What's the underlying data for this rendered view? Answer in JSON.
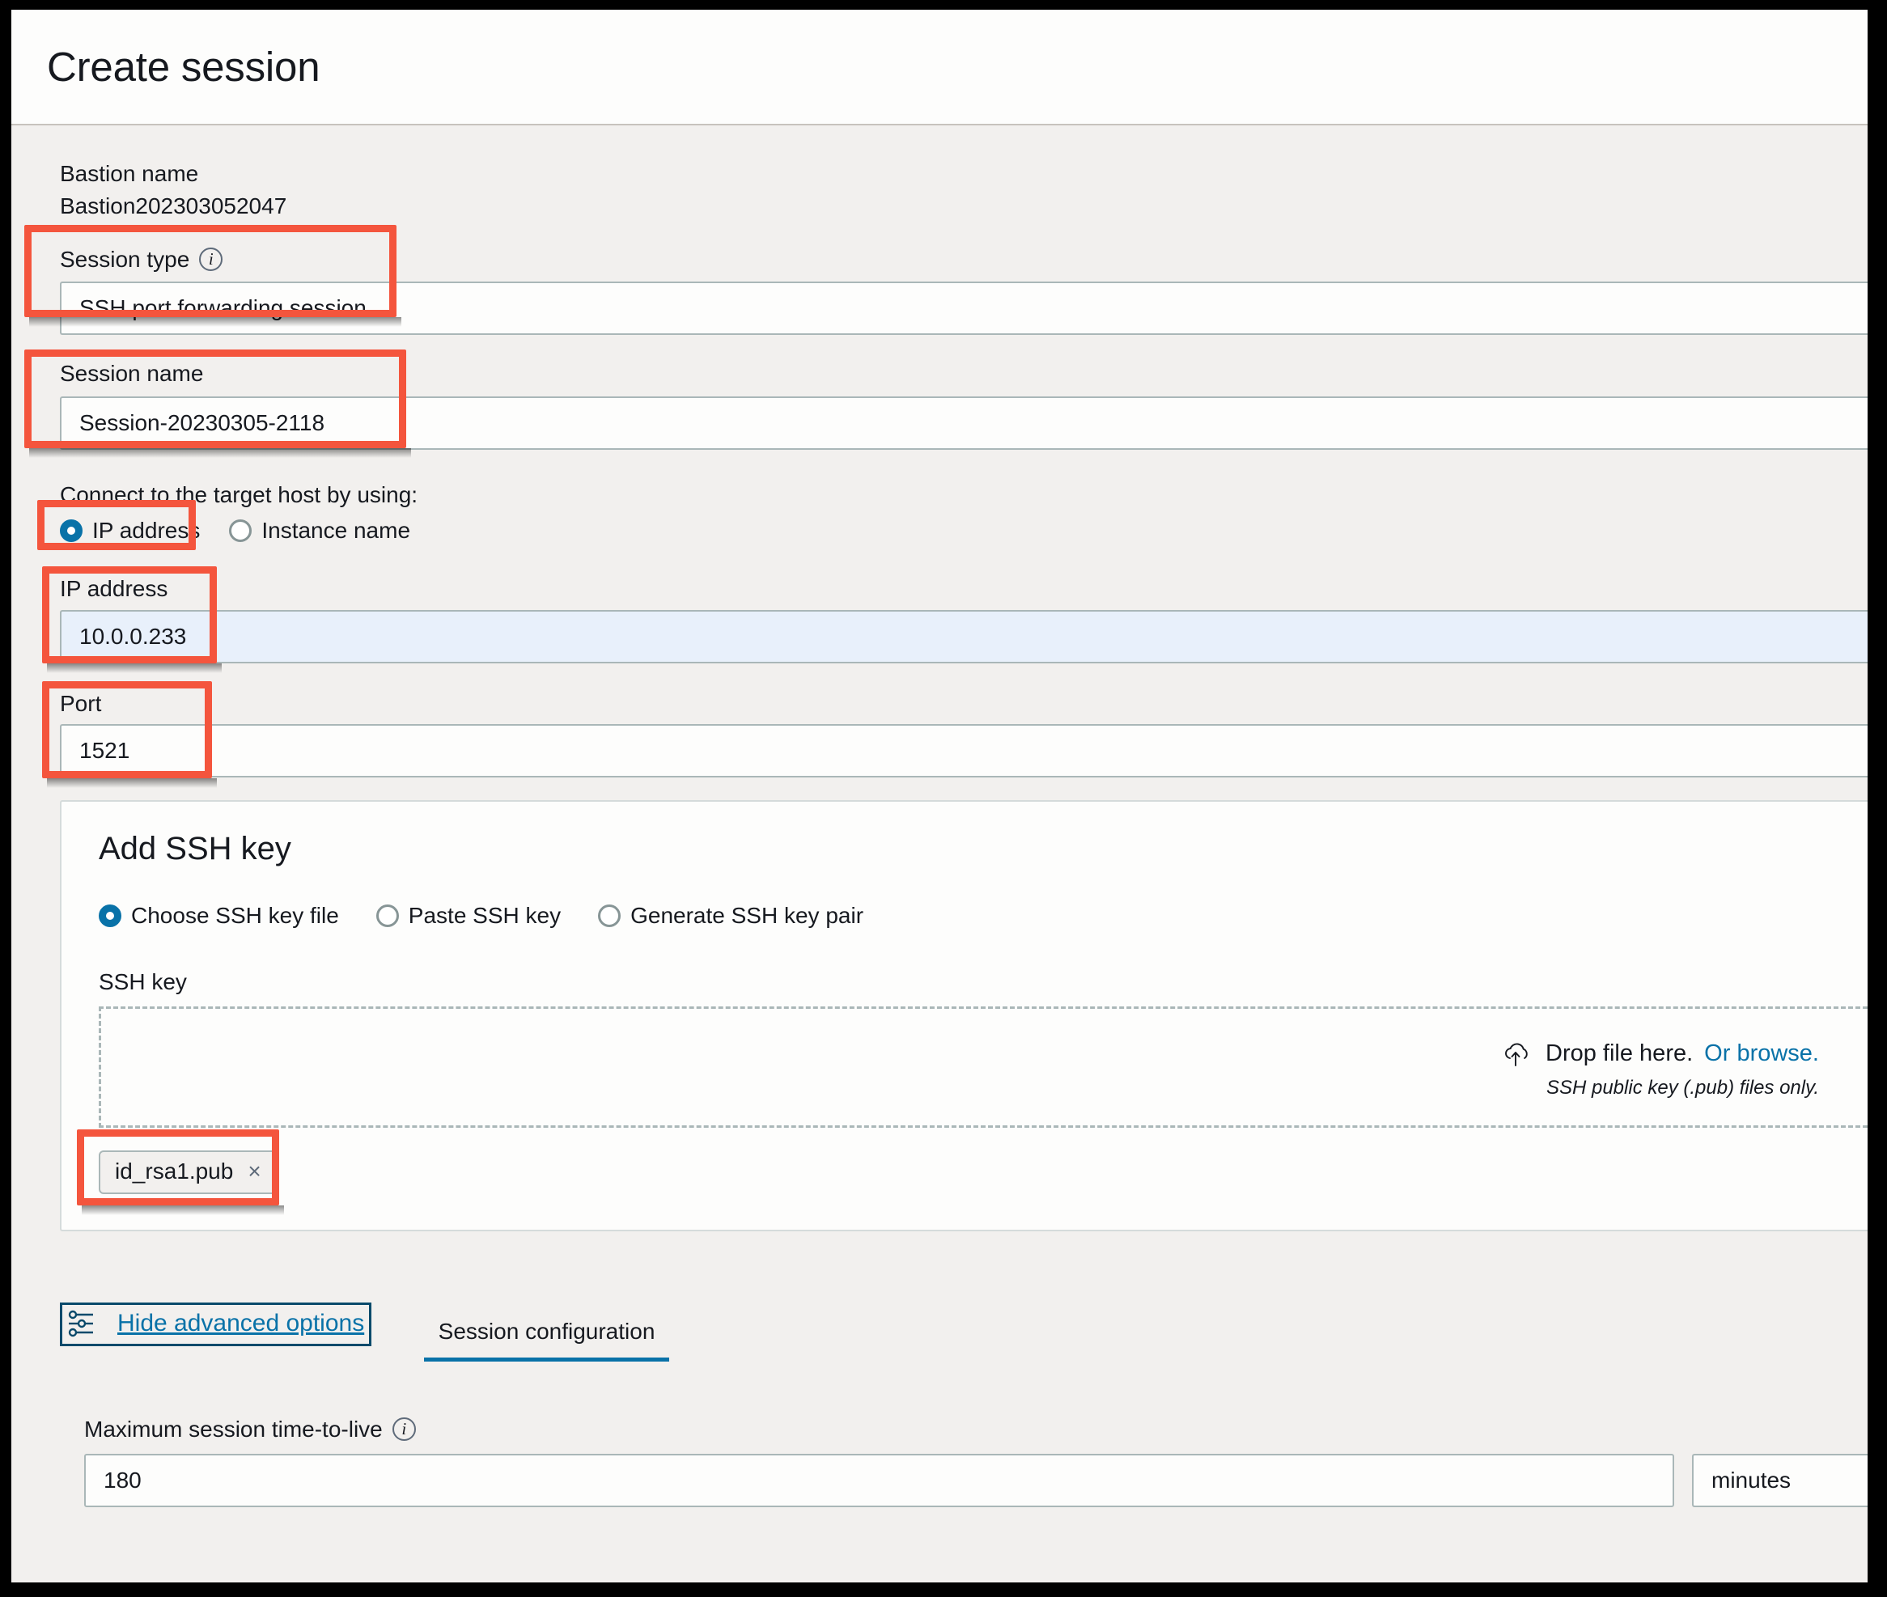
{
  "header": {
    "title": "Create session"
  },
  "form": {
    "bastion_name_label": "Bastion name",
    "bastion_name_value": "Bastion202303052047",
    "session_type_label": "Session type",
    "session_type_value": "SSH port forwarding session",
    "session_name_label": "Session name",
    "session_name_value": "Session-20230305-2118",
    "connect_label": "Connect to the target host by using:",
    "connect_options": [
      {
        "label": "IP address",
        "selected": true
      },
      {
        "label": "Instance name",
        "selected": false
      }
    ],
    "ip_label": "IP address",
    "ip_value": "10.0.0.233",
    "port_label": "Port",
    "port_value": "1521"
  },
  "ssh_key": {
    "title": "Add SSH key",
    "options": [
      {
        "label": "Choose SSH key file",
        "selected": true
      },
      {
        "label": "Paste SSH key",
        "selected": false
      },
      {
        "label": "Generate SSH key pair",
        "selected": false
      }
    ],
    "field_label": "SSH key",
    "drop_text": "Drop file here.",
    "browse_text": "Or browse.",
    "hint": "SSH public key (.pub) files only.",
    "file_chip": "id_rsa1.pub",
    "chip_remove": "×"
  },
  "advanced": {
    "link_label": "Hide advanced options",
    "tab_label": "Session configuration",
    "ttl_label": "Maximum session time-to-live",
    "ttl_value": "180",
    "ttl_unit": "minutes"
  },
  "icons": {
    "info": "i"
  },
  "colors": {
    "annotation": "#f4553d",
    "annotation_dark": "#0a4a6b",
    "link": "#0972a8",
    "accent": "#0972a8",
    "page_bg": "#f2f0ee",
    "field_focus_bg": "#e8f0fb"
  }
}
